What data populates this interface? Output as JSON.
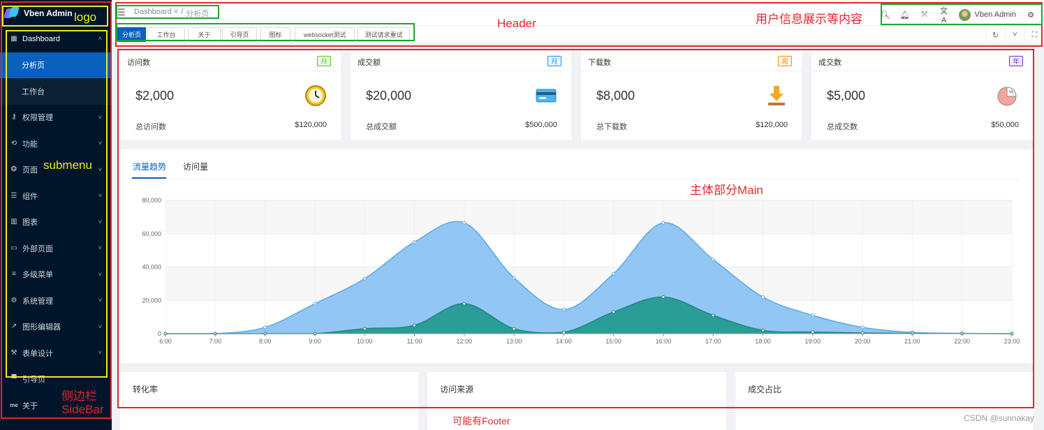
{
  "app": {
    "logo_text": "Vben Admin"
  },
  "sidebar": {
    "items": [
      {
        "label": "Dashboard",
        "icon": "grid-icon",
        "glyph": "▦",
        "chevron": "˄",
        "state": "open"
      },
      {
        "label": "分析页",
        "state": "active-sub"
      },
      {
        "label": "工作台",
        "state": "sub"
      },
      {
        "label": "权限管理",
        "icon": "key-icon",
        "glyph": "⚷",
        "chevron": "˅"
      },
      {
        "label": "功能",
        "icon": "tool-icon",
        "glyph": "⟲",
        "chevron": "˅"
      },
      {
        "label": "页面",
        "icon": "pages-icon",
        "glyph": "❂",
        "chevron": "˅"
      },
      {
        "label": "组件",
        "icon": "layers-icon",
        "glyph": "☰",
        "chevron": "˅"
      },
      {
        "label": "图表",
        "icon": "chart-icon",
        "glyph": "▥",
        "chevron": "˅"
      },
      {
        "label": "外部页面",
        "icon": "monitor-icon",
        "glyph": "▭",
        "chevron": "˅"
      },
      {
        "label": "多级菜单",
        "icon": "menu-icon",
        "glyph": "≡",
        "chevron": "˅"
      },
      {
        "label": "系统管理",
        "icon": "gear-icon",
        "glyph": "⚙",
        "chevron": "˅"
      },
      {
        "label": "图形编辑器",
        "icon": "line-chart-icon",
        "glyph": "↗",
        "chevron": "˅"
      },
      {
        "label": "表单设计",
        "icon": "wrench-icon",
        "glyph": "⚒",
        "chevron": "˅"
      },
      {
        "label": "引导页",
        "icon": "paint-roller-icon",
        "glyph": "▀",
        "chevron": ""
      },
      {
        "label": "关于",
        "icon": "me-icon",
        "glyph": "me",
        "chevron": ""
      }
    ]
  },
  "header": {
    "breadcrumb": [
      "Dashboard",
      "/",
      "分析页"
    ],
    "breadcrumb_chevron": "˅",
    "user_name": "Vben Admin"
  },
  "tabs": [
    {
      "label": "分析页",
      "active": true
    },
    {
      "label": "工作台"
    },
    {
      "label": "关于"
    },
    {
      "label": "引导页"
    },
    {
      "label": "图标"
    },
    {
      "label": "websocket测试"
    },
    {
      "label": "测试请求重试"
    }
  ],
  "cards": [
    {
      "title": "访问数",
      "tag": "月",
      "tag_color": "#52c41a",
      "value": "$2,000",
      "footer_label": "总访问数",
      "footer_total": "$120,000",
      "icon": "clock-icon"
    },
    {
      "title": "成交额",
      "tag": "月",
      "tag_color": "#1890ff",
      "value": "$20,000",
      "footer_label": "总成交额",
      "footer_total": "$500,000",
      "icon": "credit-card-icon"
    },
    {
      "title": "下载数",
      "tag": "周",
      "tag_color": "#fa8c16",
      "value": "$8,000",
      "footer_label": "总下载数",
      "footer_total": "$120,000",
      "icon": "download-icon"
    },
    {
      "title": "成交数",
      "tag": "年",
      "tag_color": "#722ed1",
      "value": "$5,000",
      "footer_label": "总成交数",
      "footer_total": "$50,000",
      "icon": "pie-icon"
    }
  ],
  "chart_tabs": [
    "流量趋势",
    "访问量"
  ],
  "chart_data": {
    "type": "area",
    "x": [
      "6:00",
      "7:00",
      "8:00",
      "9:00",
      "10:00",
      "11:00",
      "12:00",
      "13:00",
      "14:00",
      "15:00",
      "16:00",
      "17:00",
      "18:00",
      "19:00",
      "20:00",
      "21:00",
      "22:00",
      "23:00"
    ],
    "ylim": [
      0,
      80000
    ],
    "yticks": [
      0,
      20000,
      40000,
      60000,
      80000
    ],
    "ytick_labels": [
      "0",
      "20,000",
      "40,000",
      "60,000",
      "80,000"
    ],
    "grid": true,
    "series": [
      {
        "values": [
          0,
          0,
          3800,
          18000,
          33000,
          55000,
          66500,
          33500,
          14500,
          36000,
          66500,
          44500,
          22000,
          11000,
          3800,
          800,
          200,
          0
        ],
        "color": "#8cc4f2",
        "stroke": "#5aa8e8"
      },
      {
        "values": [
          0,
          0,
          0,
          0,
          3000,
          5000,
          18000,
          3000,
          800,
          13000,
          22000,
          11000,
          2000,
          1000,
          400,
          200,
          100,
          0
        ],
        "color": "#2a9d97",
        "stroke": "#1e857f"
      }
    ]
  },
  "bottom_cards": [
    "转化率",
    "访问来源",
    "成交占比"
  ],
  "annotations": {
    "logo": "logo",
    "header": "Header",
    "user_info": "用户信息展示等内容",
    "submenu": "submenu",
    "main": "主体部分Main",
    "sidebar": "侧边栏",
    "sidebar_en": "SideBar",
    "footer": "可能有Footer"
  },
  "watermark": "CSDN @sunnakay"
}
